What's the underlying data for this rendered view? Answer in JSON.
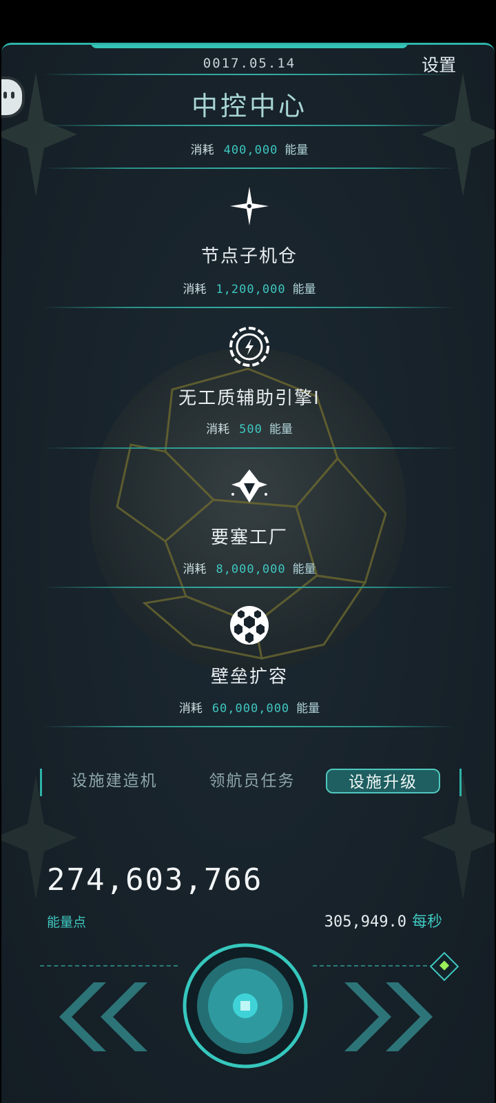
{
  "header": {
    "date": "0017.05.14",
    "settings_label": "设置",
    "title": "中控中心"
  },
  "top_cost": {
    "label": "消耗",
    "value": "400,000",
    "unit": "能量"
  },
  "upgrades": [
    {
      "name": "节点子机仓",
      "icon": "sparkle-icon",
      "cost_label": "消耗",
      "cost": "1,200,000",
      "unit": "能量"
    },
    {
      "name": "无工质辅助引擎I",
      "icon": "lightning-gear-icon",
      "cost_label": "消耗",
      "cost": "500",
      "unit": "能量"
    },
    {
      "name": "要塞工厂",
      "icon": "spaceship-icon",
      "cost_label": "消耗",
      "cost": "8,000,000",
      "unit": "能量"
    },
    {
      "name": "壁垒扩容",
      "icon": "hex-sphere-icon",
      "cost_label": "消耗",
      "cost": "60,000,000",
      "unit": "能量"
    }
  ],
  "tabs": [
    {
      "label": "设施建造机",
      "active": false
    },
    {
      "label": "领航员任务",
      "active": false
    },
    {
      "label": "设施升级",
      "active": true
    }
  ],
  "energy": {
    "total": "274,603,766",
    "label": "能量点",
    "rate": "305,949.0",
    "rate_unit": "每秒"
  },
  "colors": {
    "accent": "#3ec8c0",
    "frame": "#2fb3a8",
    "panel_bg": "#18232b"
  }
}
